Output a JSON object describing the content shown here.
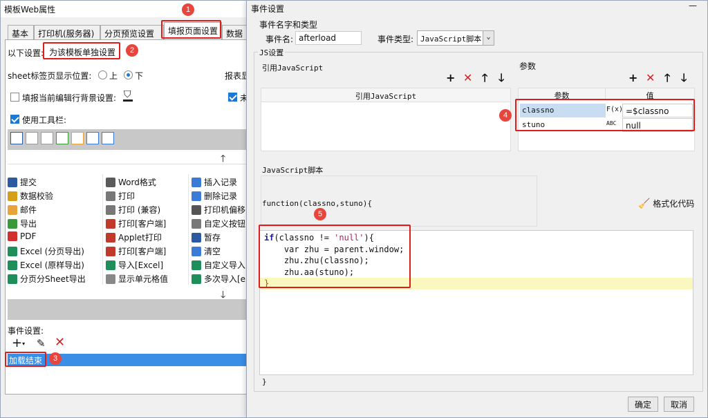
{
  "left_window": {
    "title": "模板Web属性",
    "tabs": [
      "基本",
      "打印机(服务器)",
      "分页预览设置",
      "填报页面设置",
      "数据"
    ],
    "setting_label": "以下设置:",
    "setting_value": "为该模板单独设置",
    "sheet_pos_label": "sheet标签页显示位置:",
    "sheet_pos_up": "上",
    "sheet_pos_down": "下",
    "report_label": "报表显",
    "bg_label": "填报当前编辑行背景设置:",
    "right_cb_label": "未",
    "toolbar_label": "使用工具栏:",
    "event_label": "事件设置:",
    "event_item": "加载结束",
    "buttons": [
      {
        "label": "提交",
        "icon": "save-icon",
        "color": "#2c5aa0"
      },
      {
        "label": "Word格式",
        "icon": "word-icon",
        "color": "#5a5a5a"
      },
      {
        "label": "插入记录",
        "icon": "insert-row-icon",
        "color": "#3a7bd5"
      },
      {
        "label": "数据校验",
        "icon": "pencil-icon",
        "color": "#d4a017"
      },
      {
        "label": "打印",
        "icon": "printer-icon",
        "color": "#777777"
      },
      {
        "label": "删除记录",
        "icon": "delete-row-icon",
        "color": "#3a7bd5"
      },
      {
        "label": "邮件",
        "icon": "mail-icon",
        "color": "#e8a33c"
      },
      {
        "label": "打印 (兼容)",
        "icon": "printer-icon",
        "color": "#777777"
      },
      {
        "label": "打印机偏移",
        "icon": "move-icon",
        "color": "#555555"
      },
      {
        "label": "导出",
        "icon": "export-icon",
        "color": "#3a9a3a"
      },
      {
        "label": "打印[客户端]",
        "icon": "printer-client-icon",
        "color": "#c0392b"
      },
      {
        "label": "自定义按钮",
        "icon": "gear-icon",
        "color": "#777777"
      },
      {
        "label": "PDF",
        "icon": "pdf-icon",
        "color": "#d32f2f"
      },
      {
        "label": "Applet打印",
        "icon": "applet-icon",
        "color": "#c0392b"
      },
      {
        "label": "暂存",
        "icon": "save-icon",
        "color": "#2c5aa0"
      },
      {
        "label": "Excel (分页导出)",
        "icon": "excel-icon",
        "color": "#1e8e5a"
      },
      {
        "label": "打印[客户端]",
        "icon": "printer-client-icon",
        "color": "#c0392b"
      },
      {
        "label": "清空",
        "icon": "eraser-icon",
        "color": "#3a7bd5"
      },
      {
        "label": "Excel (原样导出)",
        "icon": "excel-icon",
        "color": "#1e8e5a"
      },
      {
        "label": "导入[Excel]",
        "icon": "excel-icon",
        "color": "#1e8e5a"
      },
      {
        "label": "自定义导入",
        "icon": "excel-icon",
        "color": "#1e8e5a"
      },
      {
        "label": "分页分Sheet导出",
        "icon": "excel-icon",
        "color": "#1e8e5a"
      },
      {
        "label": "显示单元格值",
        "icon": "cell-icon",
        "color": "#888888"
      },
      {
        "label": "多次导入[e",
        "icon": "excel-icon",
        "color": "#1e8e5a"
      }
    ]
  },
  "dialog": {
    "title": "事件设置",
    "close_glyph": "—",
    "section_name_type": "事件名字和类型",
    "event_name_label": "事件名:",
    "event_name_value": "afterload",
    "event_type_label": "事件类型:",
    "event_type_value": "JavaScript脚本",
    "js_section": "JS设置",
    "ref_js_label": "引用JavaScript",
    "ref_js_header": "引用JavaScript",
    "params_label": "参数",
    "params_col1": "参数",
    "params_col2": "值",
    "params": [
      {
        "name": "classno",
        "type": "F(x)",
        "value": "=$classno"
      },
      {
        "name": "stuno",
        "type": "ABC",
        "value": "null"
      }
    ],
    "script_label": "JavaScript脚本",
    "func_signature": "function(classno,stuno){",
    "format_button": "格式化代码",
    "code_lines": [
      "if(classno != 'null'){",
      "    var zhu = parent.window;",
      "    zhu.zhu(classno);",
      "    zhu.aa(stuno);",
      "}"
    ],
    "closing_brace": "}",
    "ok_button": "确定",
    "cancel_button": "取消"
  },
  "badges": [
    "1",
    "2",
    "3",
    "4",
    "5"
  ],
  "colors": {
    "accent": "#1c78d4",
    "annotation_red": "#e01b1b",
    "badge": "#e8453c",
    "selection": "#3a8ee6",
    "highlight": "#fbf8bf"
  }
}
